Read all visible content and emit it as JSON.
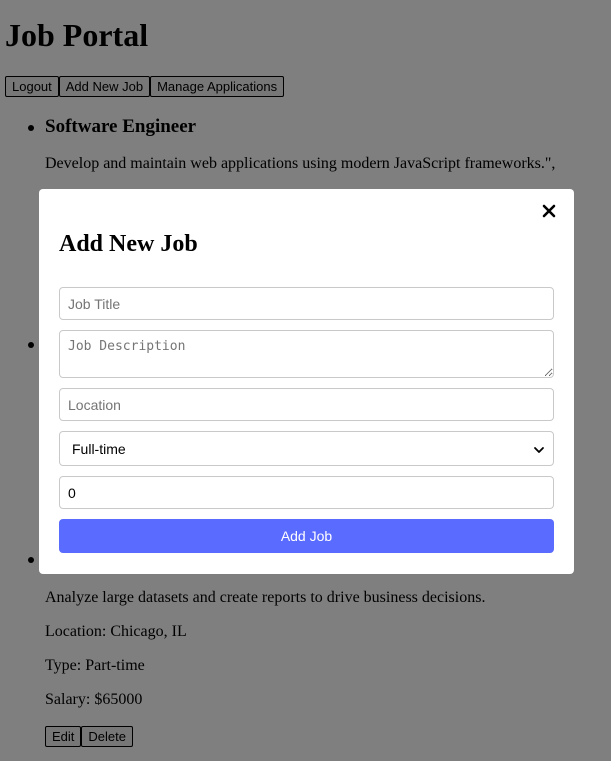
{
  "app": {
    "title": "Job Portal"
  },
  "nav": {
    "logout_label": "Logout",
    "add_job_label": "Add New Job",
    "manage_label": "Manage Applications"
  },
  "jobs": [
    {
      "title": "Software Engineer",
      "description": "Develop and maintain web applications using modern JavaScript frameworks.\","
    },
    {
      "description": "Analyze large datasets and create reports to drive business decisions.",
      "location": "Location: Chicago, IL",
      "type": "Type: Part-time",
      "salary": "Salary: $65000",
      "edit_label": "Edit",
      "delete_label": "Delete"
    }
  ],
  "modal": {
    "title": "Add New Job",
    "close_icon": "close-icon",
    "job_title_placeholder": "Job Title",
    "job_description_placeholder": "Job Description",
    "location_placeholder": "Location",
    "type_selected": "Full-time",
    "salary_value": "0",
    "submit_label": "Add Job"
  },
  "colors": {
    "overlay": "#00000080",
    "primary": "#5a6bff",
    "input_border": "#c9c9c9"
  }
}
